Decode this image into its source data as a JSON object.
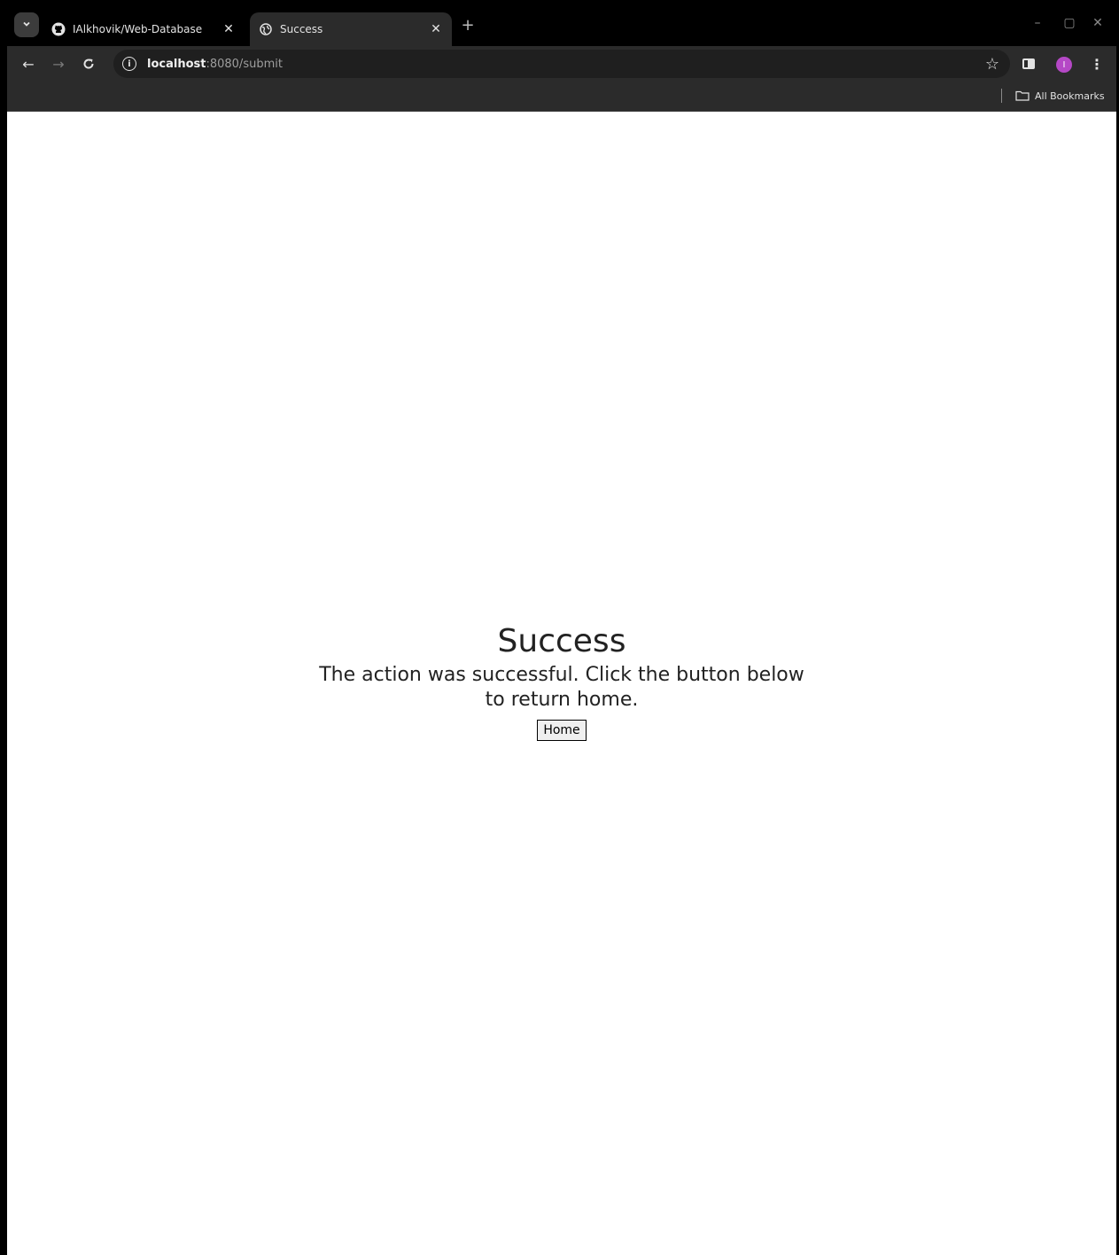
{
  "browser": {
    "tabs": [
      {
        "title": "IAlkhovik/Web-Database",
        "favicon": "github-icon",
        "active": false
      },
      {
        "title": "Success",
        "favicon": "globe-icon",
        "active": true
      }
    ],
    "new_tab_label": "+",
    "url": {
      "host": "localhost",
      "rest": ":8080/submit"
    },
    "profile_initial": "I",
    "bookmarks": {
      "all_label": "All Bookmarks"
    },
    "colors": {
      "avatar": "#b548c6",
      "toolbar": "#2b2b2b",
      "tabstrip": "#000000"
    }
  },
  "page": {
    "heading": "Success",
    "message": "The action was successful. Click the button below to return home.",
    "button_label": "Home"
  }
}
